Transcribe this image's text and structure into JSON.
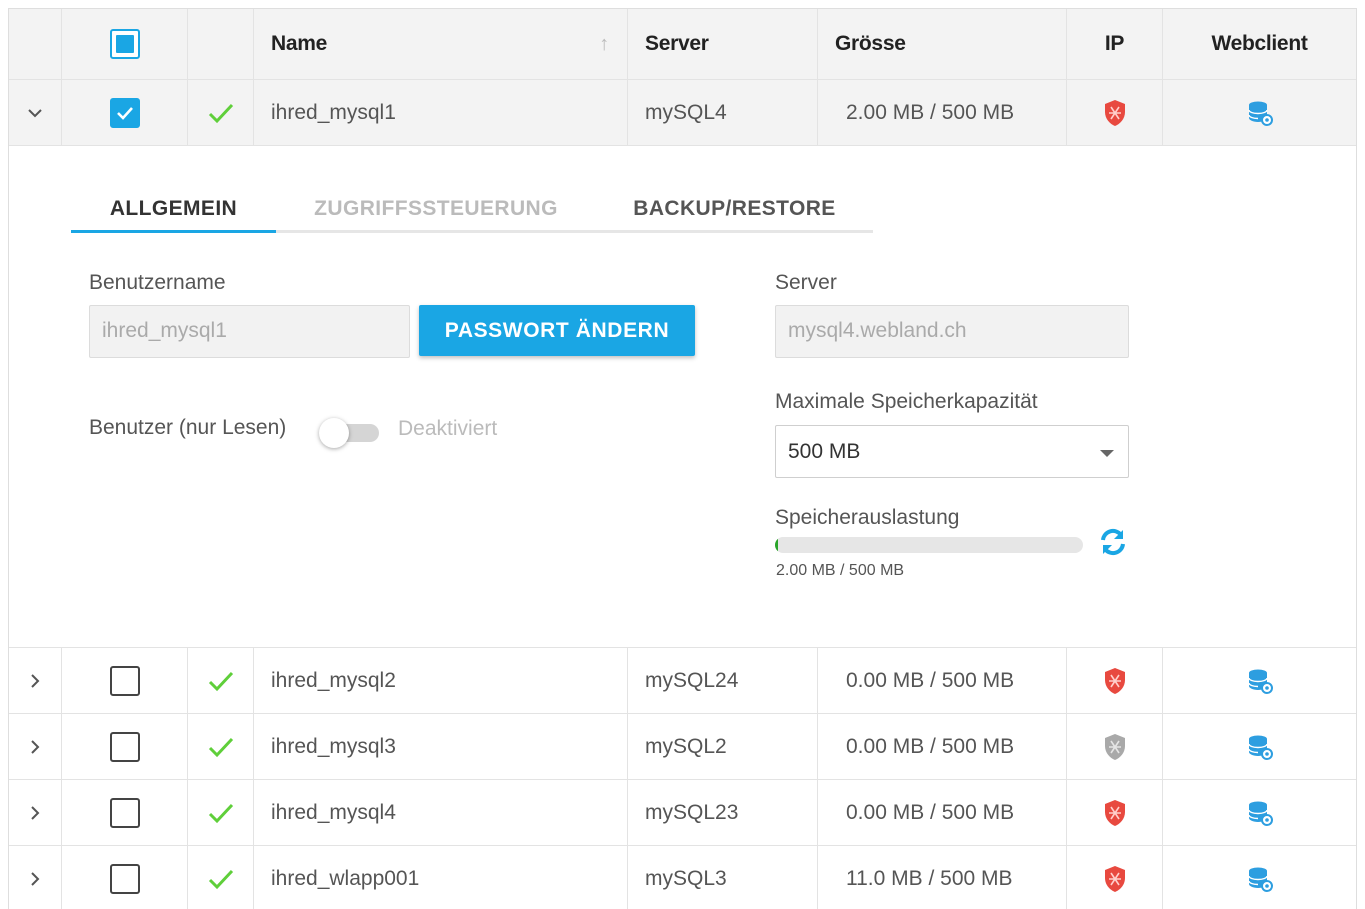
{
  "columns": {
    "name": "Name",
    "server": "Server",
    "size": "Grösse",
    "ip": "IP",
    "webclient": "Webclient"
  },
  "rows": [
    {
      "name": "ihred_mysql1",
      "server": "mySQL4",
      "size": "2.00 MB / 500 MB",
      "ip_shield": "red",
      "checked": true,
      "expanded": true
    },
    {
      "name": "ihred_mysql2",
      "server": "mySQL24",
      "size": "0.00 MB / 500 MB",
      "ip_shield": "red",
      "checked": false,
      "expanded": false
    },
    {
      "name": "ihred_mysql3",
      "server": "mySQL2",
      "size": "0.00 MB / 500 MB",
      "ip_shield": "grey",
      "checked": false,
      "expanded": false
    },
    {
      "name": "ihred_mysql4",
      "server": "mySQL23",
      "size": "0.00 MB / 500 MB",
      "ip_shield": "red",
      "checked": false,
      "expanded": false
    },
    {
      "name": "ihred_wlapp001",
      "server": "mySQL3",
      "size": "11.0 MB / 500 MB",
      "ip_shield": "red",
      "checked": false,
      "expanded": false
    }
  ],
  "detail": {
    "tabs": [
      "ALLGEMEIN",
      "ZUGRIFFSSTEUERUNG",
      "BACKUP/RESTORE"
    ],
    "username_label": "Benutzername",
    "username_value": "ihred_mysql1",
    "change_password": "PASSWORT ÄNDERN",
    "readonly_label": "Benutzer (nur Lesen)",
    "readonly_state": "Deaktiviert",
    "server_label": "Server",
    "server_value": "mysql4.webland.ch",
    "capacity_label": "Maximale Speicherkapazität",
    "capacity_value": "500 MB",
    "usage_label": "Speicherauslastung",
    "usage_text": "2.00 MB / 500 MB",
    "usage_fraction": 0.004
  },
  "colors": {
    "accent": "#1aa6e4",
    "check_green": "#5fcf3a",
    "shield_red": "#e8493f",
    "shield_grey": "#a9a9a9",
    "progress_green": "#2aa52a"
  },
  "icons": {
    "sort": "arrow-up-icon",
    "status": "checkmark-icon",
    "ip": "shield-icon",
    "webclient": "database-icon",
    "refresh": "refresh-icon"
  }
}
